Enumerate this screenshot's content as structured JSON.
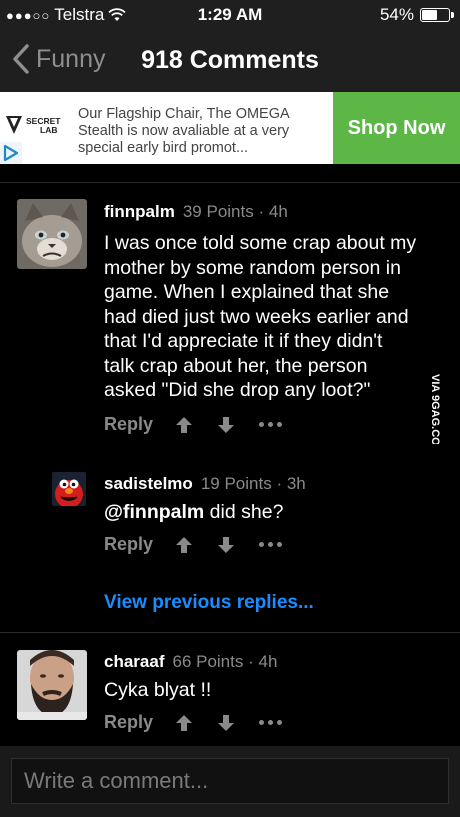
{
  "status_bar": {
    "carrier": "Telstra",
    "time": "1:29 AM",
    "battery": "54%",
    "battery_level": 0.54
  },
  "nav": {
    "back_label": "Funny",
    "title": "918 Comments"
  },
  "ad": {
    "logo_line1": "SECRET",
    "logo_line2": "LAB",
    "text": "Our Flagship Chair, The OMEGA Stealth is now avaliable at a very special early bird promot...",
    "cta": "Shop Now"
  },
  "comments": [
    {
      "username": "finnpalm",
      "points": "39 Points",
      "sep": "·",
      "age": "4h",
      "lines": [
        "I was once told some crap about my",
        "mother by some random person in",
        "game. When I explained that she",
        "had died just two weeks earlier and",
        "that I'd appreciate it if they didn't",
        "talk crap about her, the person",
        "asked \"Did she drop any loot?\""
      ],
      "reply_label": "Reply"
    },
    {
      "username": "sadistelmo",
      "points": "19 Points",
      "sep": "·",
      "age": "3h",
      "mention": "@finnpalm",
      "text": " did she?",
      "reply_label": "Reply"
    },
    {
      "username": "charaaf",
      "points": "66 Points",
      "sep": "·",
      "age": "4h",
      "text": "Cyka blyat !!",
      "reply_label": "Reply"
    }
  ],
  "view_previous": "View previous replies...",
  "watermark": "VIA 9GAG.COM",
  "composer": {
    "placeholder": "Write a comment..."
  },
  "colors": {
    "accent_blue": "#1a8cff",
    "ad_green": "#5db746",
    "muted": "#8a8a8a"
  }
}
